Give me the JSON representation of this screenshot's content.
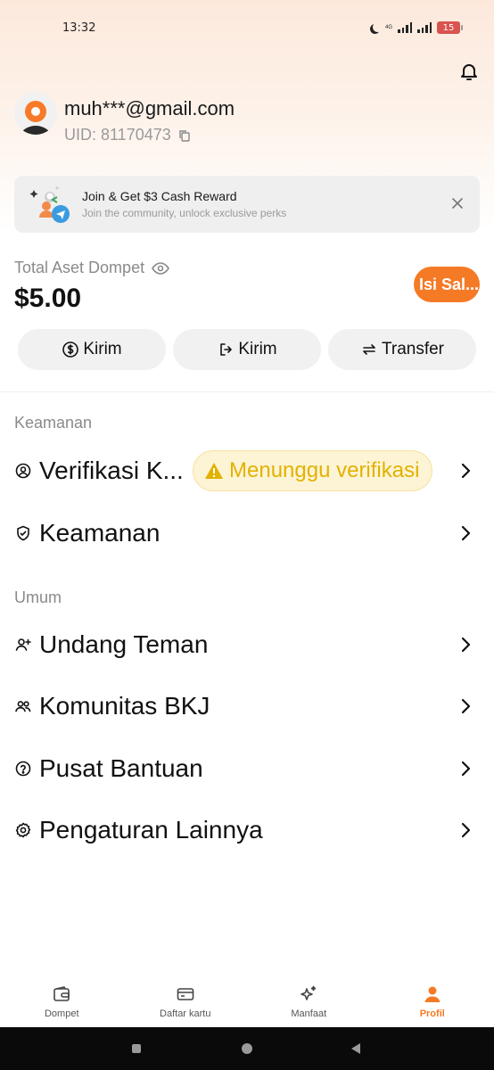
{
  "status_bar": {
    "time": "13:32",
    "network": "4G",
    "battery": "15"
  },
  "profile": {
    "email": "muh***@gmail.com",
    "uid": "UID: 81170473"
  },
  "banner": {
    "title": "Join & Get $3 Cash Reward",
    "subtitle": "Join the community, unlock exclusive perks"
  },
  "balance": {
    "label": "Total Aset Dompet",
    "value": "$5.00",
    "topup_label": "Isi Sal..."
  },
  "actions": [
    {
      "label": "Kirim",
      "icon": "dollar-circle-icon"
    },
    {
      "label": "Kirim",
      "icon": "logout-arrow-icon"
    },
    {
      "label": "Transfer",
      "icon": "swap-arrows-icon"
    }
  ],
  "security": {
    "title": "Keamanan",
    "items": [
      {
        "label": "Verifikasi K...",
        "icon": "user-circle-icon",
        "badge": "Menunggu verifikasi"
      },
      {
        "label": "Keamanan",
        "icon": "shield-check-icon"
      }
    ]
  },
  "general": {
    "title": "Umum",
    "items": [
      {
        "label": "Undang Teman",
        "icon": "user-plus-icon"
      },
      {
        "label": "Komunitas BKJ",
        "icon": "users-icon"
      },
      {
        "label": "Pusat Bantuan",
        "icon": "help-circle-icon"
      },
      {
        "label": "Pengaturan Lainnya",
        "icon": "gear-icon"
      }
    ]
  },
  "nav": [
    {
      "label": "Dompet",
      "icon": "wallet-icon",
      "active": false
    },
    {
      "label": "Daftar kartu",
      "icon": "card-icon",
      "active": false
    },
    {
      "label": "Manfaat",
      "icon": "sparkle-icon",
      "active": false
    },
    {
      "label": "Profil",
      "icon": "person-icon",
      "active": true
    }
  ],
  "colors": {
    "accent": "#f57a26",
    "warning": "#e3b100",
    "warning_bg": "#fdf4d5"
  }
}
